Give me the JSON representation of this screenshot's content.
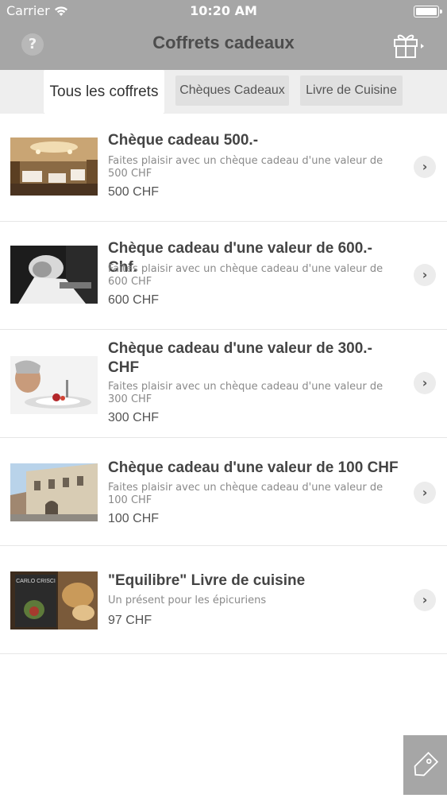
{
  "status": {
    "carrier": "Carrier",
    "time": "10:20 AM"
  },
  "header": {
    "title": "Coffrets cadeaux",
    "help_glyph": "?"
  },
  "tabs": [
    {
      "label": "Tous les coffrets",
      "active": true
    },
    {
      "label": "Chèques Cadeaux",
      "active": false
    },
    {
      "label": "Livre de Cuisine",
      "active": false
    }
  ],
  "items": [
    {
      "title": "Chèque cadeau 500.-",
      "description": "Faites plaisir avec un chèque cadeau d'une valeur de 500 CHF",
      "price": "500 CHF"
    },
    {
      "title": "Chèque cadeau d'une valeur de 600.- Chf.",
      "description": "Faites plaisir avec un chèque cadeau d'une valeur de 600 CHF",
      "price": "600 CHF"
    },
    {
      "title": "Chèque cadeau d'une valeur de 300.- CHF",
      "description": "Faites plaisir avec un chèque cadeau d'une valeur de 300 CHF",
      "price": "300 CHF"
    },
    {
      "title": "Chèque cadeau d'une valeur de 100 CHF",
      "description": "Faites plaisir avec un chèque cadeau d'une valeur de 100 CHF",
      "price": "100 CHF"
    },
    {
      "title": "\"Equilibre\" Livre de cuisine",
      "description": "Un présent pour les épicuriens",
      "price": "97 CHF"
    }
  ],
  "book_cover_text": "CARLO CRISCI",
  "icons": {
    "help": "question-icon",
    "gift": "gift-icon",
    "chevron": "chevron-right-icon",
    "tag": "tag-icon",
    "wifi": "wifi-icon",
    "battery": "battery-icon"
  },
  "colors": {
    "header_bg": "#a6a6a6",
    "tab_bar_bg": "#eeeeee",
    "title_text": "#4d4d4d"
  }
}
